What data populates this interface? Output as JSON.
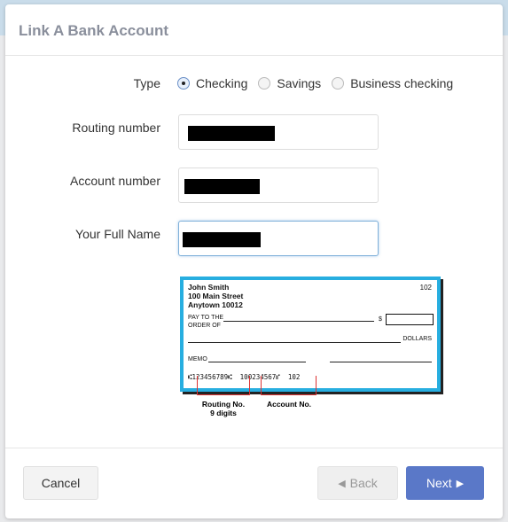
{
  "modal": {
    "title": "Link A Bank Account"
  },
  "form": {
    "type_label": "Type",
    "type_options": [
      {
        "label": "Checking",
        "selected": true
      },
      {
        "label": "Savings",
        "selected": false
      },
      {
        "label": "Business checking",
        "selected": false
      }
    ],
    "routing_label": "Routing number",
    "account_label": "Account number",
    "name_label": "Your Full Name"
  },
  "check": {
    "name": "John Smith",
    "street": "100 Main Street",
    "city": "Anytown 10012",
    "number": "102",
    "pay_to": "PAY TO THE",
    "order_of": "ORDER OF",
    "dollar_sign": "$",
    "dollars": "DOLLARS",
    "memo": "MEMO",
    "micr": "⑆123456789⑆  100234567⑈  102",
    "routing_caption": "Routing No.",
    "routing_sub": "9 digits",
    "account_caption": "Account No.",
    "accent": "#27aee0"
  },
  "footer": {
    "cancel": "Cancel",
    "back": "Back",
    "next": "Next"
  },
  "colors": {
    "primary": "#5a78c8"
  }
}
